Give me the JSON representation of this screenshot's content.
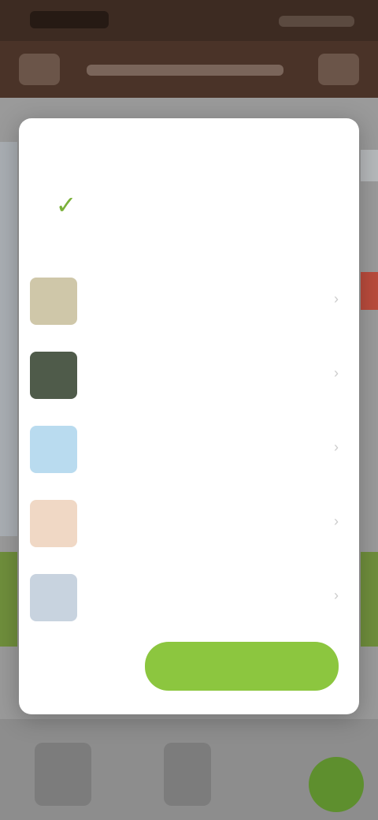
{
  "status_bar": {
    "time": "",
    "icons": [
      "signal-icon",
      "wifi-icon",
      "battery-icon"
    ]
  },
  "app_bar": {
    "title": "",
    "menu_icon": "menu-icon",
    "action_icon": "more-icon"
  },
  "dialog": {
    "title": "",
    "info_text": "",
    "items": [
      {
        "name": "",
        "subtitle": "",
        "thumb_color": "#cfc7a9"
      },
      {
        "name": "",
        "subtitle": "",
        "thumb_color": "#4f5b4a"
      },
      {
        "name": "",
        "subtitle": "",
        "thumb_color": "#b9dbef"
      },
      {
        "name": "",
        "subtitle": "",
        "thumb_color": "#f0d8c5"
      },
      {
        "name": "",
        "subtitle": "",
        "thumb_color": "#c8d3df"
      }
    ],
    "cancel_label": "",
    "primary_label": ""
  },
  "colors": {
    "accent": "#8cc63f",
    "app_bar": "#4a3328",
    "status_bar": "#3d2b22",
    "scrim": "#9a9a9a",
    "dialog_bg": "#ffffff"
  }
}
